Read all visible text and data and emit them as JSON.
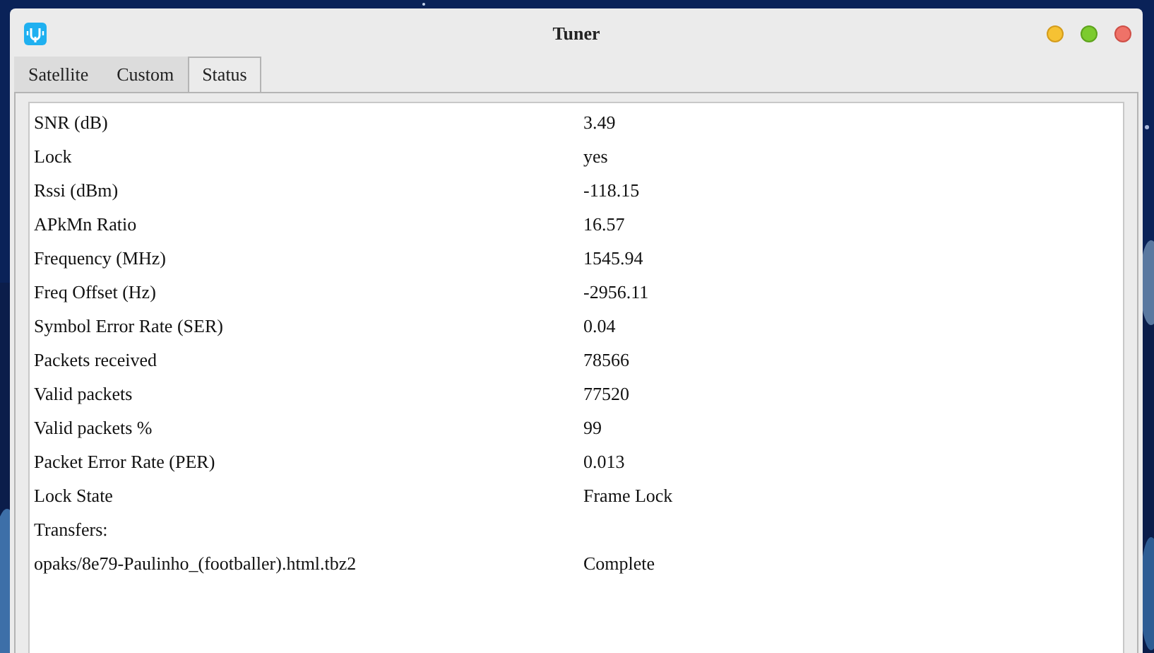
{
  "window": {
    "title": "Tuner"
  },
  "tabs": [
    {
      "label": "Satellite",
      "selected": false
    },
    {
      "label": "Custom",
      "selected": false
    },
    {
      "label": "Status",
      "selected": true
    }
  ],
  "rows": [
    {
      "label": "SNR (dB)",
      "value": "3.49"
    },
    {
      "label": "Lock",
      "value": "yes"
    },
    {
      "label": "Rssi (dBm)",
      "value": "-118.15"
    },
    {
      "label": "APkMn Ratio",
      "value": "16.57"
    },
    {
      "label": "Frequency (MHz)",
      "value": "1545.94"
    },
    {
      "label": "Freq Offset (Hz)",
      "value": "-2956.11"
    },
    {
      "label": "Symbol Error Rate (SER)",
      "value": "0.04"
    },
    {
      "label": "Packets received",
      "value": "78566"
    },
    {
      "label": "Valid packets",
      "value": "77520"
    },
    {
      "label": "Valid packets %",
      "value": "99"
    },
    {
      "label": "Packet Error Rate (PER)",
      "value": "0.013"
    },
    {
      "label": "Lock State",
      "value": "Frame Lock"
    },
    {
      "label": "Transfers:"
    },
    {
      "label": "opaks/8e79-Paulinho_(footballer).html.tbz2",
      "value": "Complete"
    }
  ]
}
